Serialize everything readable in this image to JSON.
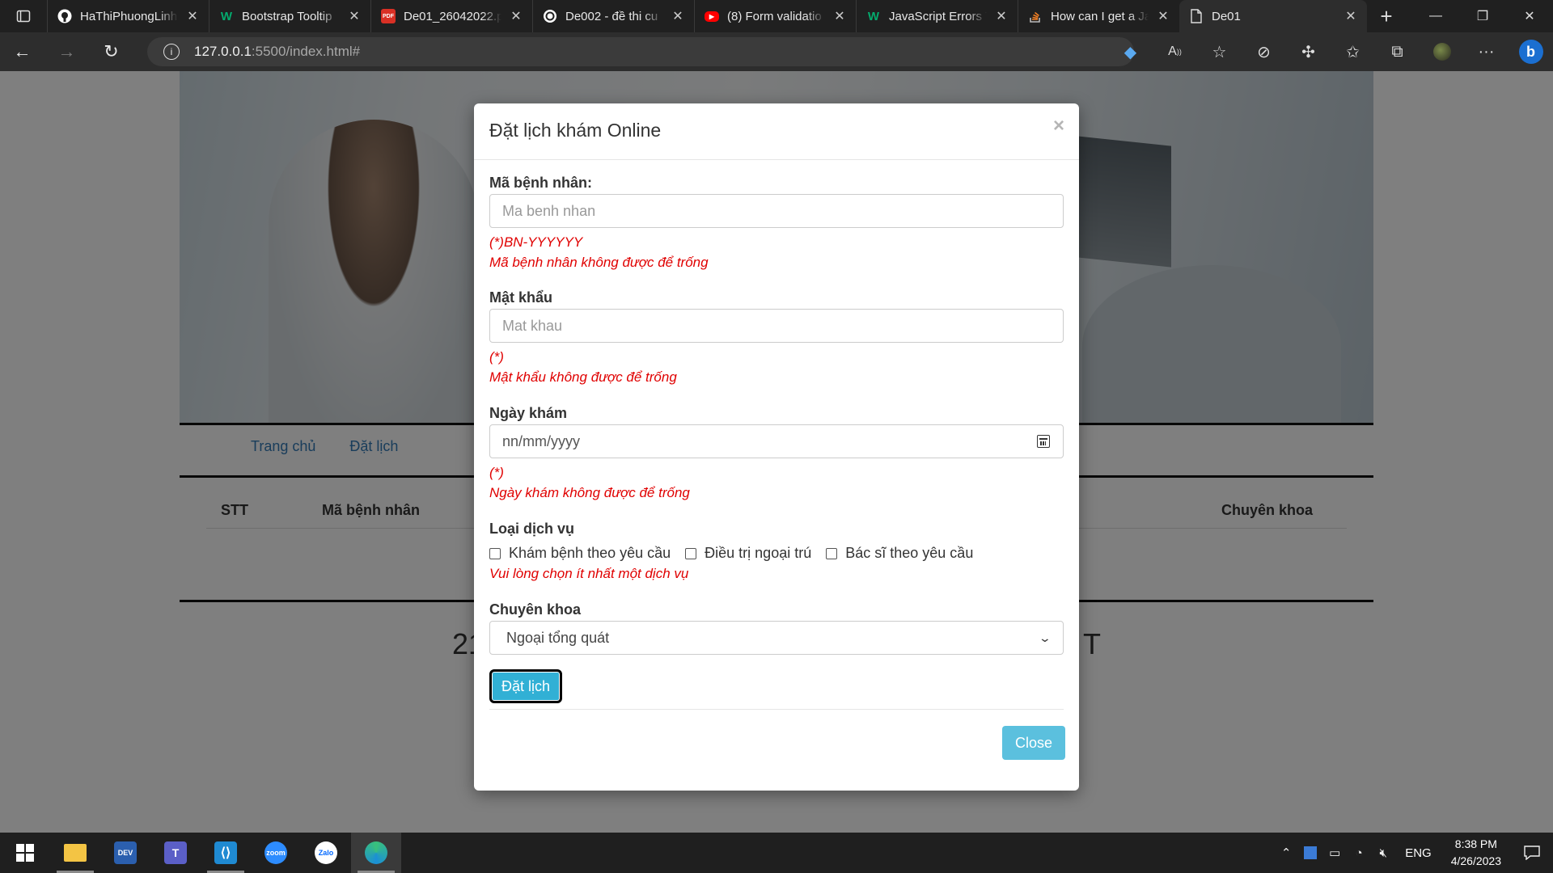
{
  "browser": {
    "tabs": [
      {
        "title": "HaThiPhuongLinh",
        "favicon": "github-icon"
      },
      {
        "title": "Bootstrap Tooltip",
        "favicon": "w3schools-icon"
      },
      {
        "title": "De01_26042022.p",
        "favicon": "pdf-icon"
      },
      {
        "title": "De002 - đề thi cu",
        "favicon": "openai-icon"
      },
      {
        "title": "(8) Form validatio",
        "favicon": "youtube-icon"
      },
      {
        "title": "JavaScript Errors T",
        "favicon": "w3schools-icon"
      },
      {
        "title": "How can I get a Ja",
        "favicon": "stackoverflow-icon"
      },
      {
        "title": "De01",
        "favicon": "page-icon"
      }
    ],
    "address": {
      "host": "127.0.0.1",
      "path": ":5500/index.html#"
    }
  },
  "page": {
    "nav": [
      "Trang chủ",
      "Đặt lịch"
    ],
    "table_headers": {
      "stt": "STT",
      "ma": "Mã bệnh nhân",
      "chuyen_khoa": "Chuyên khoa"
    },
    "footer_left": "21",
    "footer_right": "T"
  },
  "modal": {
    "title": "Đặt lịch khám Online",
    "close_x": "×",
    "ma_label": "Mã bệnh nhân:",
    "ma_placeholder": "Ma benh nhan",
    "ma_hint": "(*)BN-YYYYYY",
    "ma_error": "Mã bệnh nhân không được để trống",
    "mk_label": "Mật khẩu",
    "mk_placeholder": "Mat khau",
    "mk_hint": "(*)",
    "mk_error": "Mật khẩu không được để trống",
    "ngay_label": "Ngày khám",
    "ngay_placeholder": "nn/mm/yyyy",
    "ngay_hint": "(*)",
    "ngay_error": "Ngày khám không được để trống",
    "dv_label": "Loại dịch vụ",
    "dv_options": [
      "Khám bệnh theo yêu cầu",
      "Điều trị ngoại trú",
      "Bác sĩ theo yêu cầu"
    ],
    "dv_error": "Vui lòng chọn ít nhất một dịch vụ",
    "ck_label": "Chuyên khoa",
    "ck_selected": "Ngoại tổng quát",
    "submit_label": "Đặt lịch",
    "close_label": "Close"
  },
  "taskbar": {
    "lang": "ENG",
    "time": "8:38 PM",
    "date": "4/26/2023"
  },
  "colors": {
    "error": "#e00000",
    "info_button": "#5bc0de",
    "link": "#337ab7"
  }
}
